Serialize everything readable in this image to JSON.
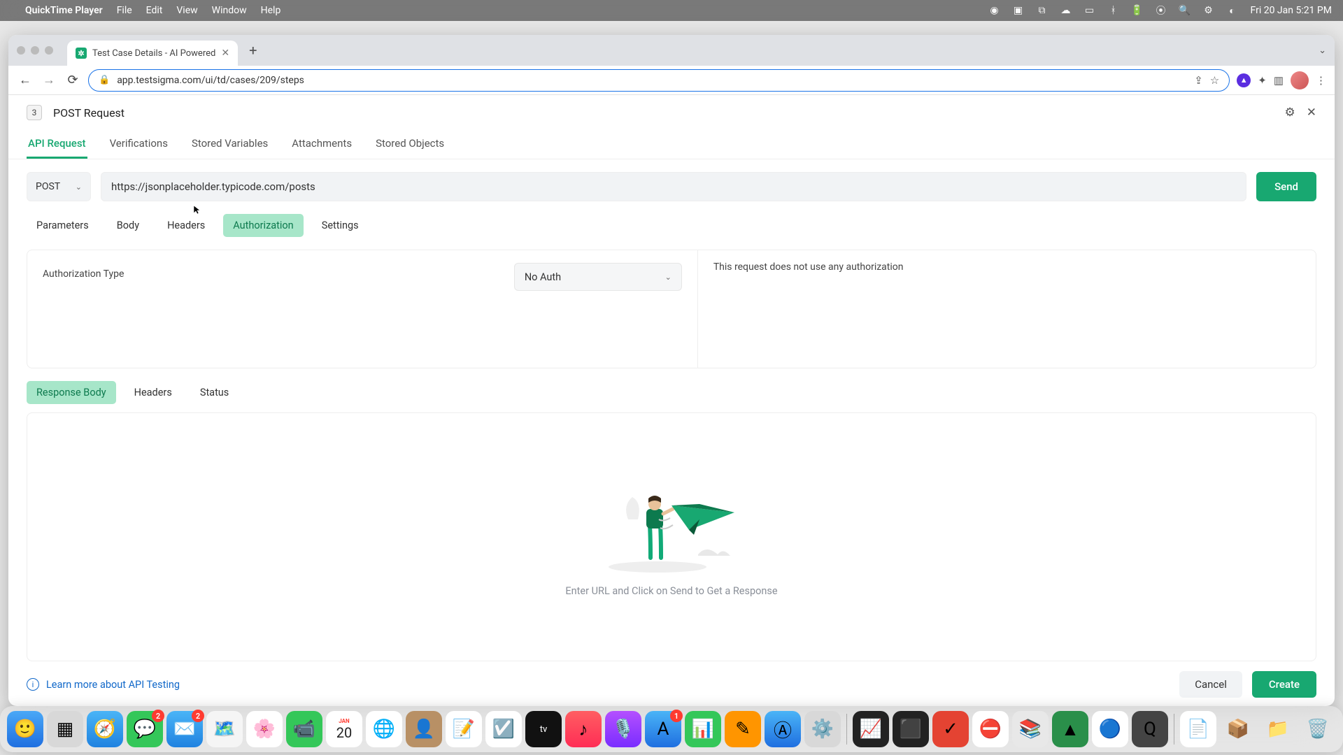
{
  "menubar": {
    "app": "QuickTime Player",
    "menus": [
      "File",
      "Edit",
      "View",
      "Window",
      "Help"
    ],
    "clock": "Fri 20 Jan  5:21 PM"
  },
  "browser": {
    "tab_title": "Test Case Details - AI Powered",
    "url_display": "app.testsigma.com/ui/td/cases/209/steps"
  },
  "page": {
    "step_number": "3",
    "title": "POST Request",
    "tabs": [
      "API Request",
      "Verifications",
      "Stored Variables",
      "Attachments",
      "Stored Objects"
    ],
    "active_tab": "API Request",
    "method": "POST",
    "url": "https://jsonplaceholder.typicode.com/posts",
    "send": "Send",
    "sub_tabs": [
      "Parameters",
      "Body",
      "Headers",
      "Authorization",
      "Settings"
    ],
    "active_sub_tab": "Authorization",
    "auth_type_label": "Authorization Type",
    "auth_selected": "No Auth",
    "auth_note": "This request does not use any authorization",
    "resp_tabs": [
      "Response Body",
      "Headers",
      "Status"
    ],
    "active_resp_tab": "Response Body",
    "resp_hint": "Enter URL and Click on Send to Get a Response",
    "learn_link": "Learn more about API Testing",
    "cancel": "Cancel",
    "create": "Create"
  },
  "dock_badges": {
    "messages": "2",
    "mail": "2",
    "appstore": "1"
  }
}
